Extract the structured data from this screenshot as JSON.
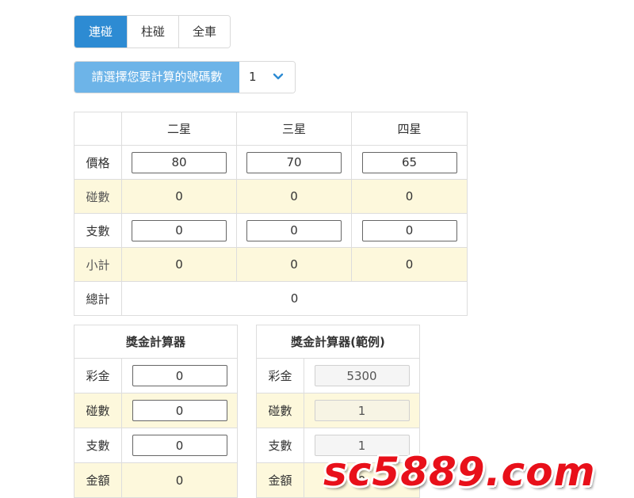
{
  "tabs": [
    {
      "label": "連碰",
      "active": true
    },
    {
      "label": "柱碰",
      "active": false
    },
    {
      "label": "全車",
      "active": false
    }
  ],
  "selector": {
    "label": "請選擇您要計算的號碼數",
    "value": "1"
  },
  "main_table": {
    "columns": [
      "二星",
      "三星",
      "四星"
    ],
    "rows": {
      "price": {
        "label": "價格",
        "values": [
          "80",
          "70",
          "65"
        ]
      },
      "hits": {
        "label": "碰數",
        "values": [
          "0",
          "0",
          "0"
        ]
      },
      "count": {
        "label": "支數",
        "values": [
          "0",
          "0",
          "0"
        ]
      },
      "subtotal": {
        "label": "小計",
        "values": [
          "0",
          "0",
          "0"
        ]
      },
      "total": {
        "label": "總計",
        "value": "0"
      }
    }
  },
  "prize_calc": {
    "title": "獎金計算器",
    "prize_label": "彩金",
    "prize_value": "0",
    "hits_label": "碰數",
    "hits_value": "0",
    "count_label": "支數",
    "count_value": "0",
    "amount_label": "金額",
    "amount_value": "0"
  },
  "prize_example": {
    "title": "獎金計算器(範例)",
    "prize_label": "彩金",
    "prize_value": "5300",
    "hits_label": "碰數",
    "hits_value": "1",
    "count_label": "支數",
    "count_value": "1",
    "amount_label": "金額",
    "amount_value": "0"
  },
  "watermark": "sc5889.com",
  "colors": {
    "tab_active": "#2d8bd3",
    "selector_label": "#6db4e8",
    "alt_row": "#fdf8dc",
    "watermark": "#e8101a"
  }
}
